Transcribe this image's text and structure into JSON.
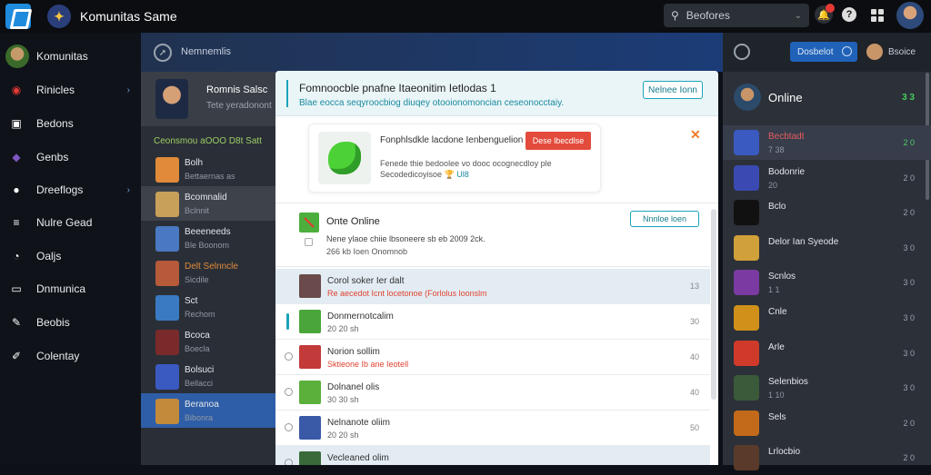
{
  "app": {
    "title": "Komunitas Same"
  },
  "search": {
    "label": "Beofores"
  },
  "sidebar": {
    "items": [
      {
        "label": "Komunitas",
        "icon": "avatar"
      },
      {
        "label": "Rinicles",
        "icon": "lips-icon",
        "color": "#e53935"
      },
      {
        "label": "Bedons",
        "icon": "briefcase-icon",
        "color": "#ffffff"
      },
      {
        "label": "Genbs",
        "icon": "puzzle-icon",
        "color": "#7e57c2"
      },
      {
        "label": "Dreeflogs",
        "icon": "gamepad-icon",
        "color": "#ffffff"
      },
      {
        "label": "Nulre Gead",
        "icon": "grid-icon",
        "color": "#ffffff"
      },
      {
        "label": "Oaljs",
        "icon": "chat-icon",
        "color": "#ffffff"
      },
      {
        "label": "Dnmunica",
        "icon": "window-icon",
        "color": "#ffffff"
      },
      {
        "label": "Beobis",
        "icon": "wrench-icon",
        "color": "#ffffff"
      },
      {
        "label": "Colentay",
        "icon": "pen-icon",
        "color": "#ffffff"
      }
    ]
  },
  "mid": {
    "header": "Nemnemlis",
    "profile": {
      "name": "Romnis Salsc",
      "sub": "Tete yeradonont"
    },
    "section": "Ceonsmou aOOO D8t Satt",
    "rows": [
      {
        "t1": "Bolh",
        "t2": "Bettaernas as",
        "color": "#e08a3a"
      },
      {
        "t1": "Bcomnalid",
        "t2": "Bclnnit",
        "color": "#c9a05a",
        "state": "sel"
      },
      {
        "t1": "Beeeneeds",
        "t2": "Ble Boonom",
        "color": "#4a78c2"
      },
      {
        "t1": "Delt Selnncle",
        "t2": "Sicdile",
        "color": "#b65a3a",
        "t1color": "#e08a3a"
      },
      {
        "t1": "Sct",
        "t2": "Rechom",
        "color": "#3a7ac2"
      },
      {
        "t1": "Bcoca",
        "t2": "Boecla",
        "color": "#7a2a2a"
      },
      {
        "t1": "Bolsuci",
        "t2": "Bellacci",
        "color": "#3a5ac2"
      },
      {
        "t1": "Beranoa",
        "t2": "Bibonra",
        "color": "#c28a3a",
        "state": "hl"
      }
    ]
  },
  "modal": {
    "title": "Fomnoocble pnafne Itaeonitim Ietlodas 1",
    "subtitle": "Blae eocca seqyroocbiog diuqey otooionomoncian ceseonocctaiy.",
    "header_button": "Nelnee Ionn",
    "promo": {
      "title": "Fonphlsdkle lacdone Ienbenguelion",
      "desc1": "Fenede thie bedoolee vo dooc ocognecdloy ple",
      "desc2": "Secodedicoyisoe",
      "desc2_link": "Ul8",
      "cta": "Dese lbecdlse"
    },
    "online": {
      "title": "Onte Online",
      "desc1": "Nene ylaoe chiie lbsoneere sb eb 2009 2ck.",
      "desc2": "266 kb Ioen Onomnob",
      "button": "Nnnloe loen"
    },
    "rows": [
      {
        "t1": "Corol soker Ier dalt",
        "t2": "Re aecedot Icnt locetonoe (Forlolus loonslm",
        "t2red": true,
        "n": "13",
        "state": "sel",
        "lead": "none",
        "color": "#6a4a4a"
      },
      {
        "t1": "Donmernotcalim",
        "t2": "20 20 sh",
        "n": "30",
        "lead": "pin",
        "color": "#4aa63a"
      },
      {
        "t1": "Norion sollim",
        "t2": "Sktieone Ib ane Ieotell",
        "t2red": true,
        "n": "40",
        "lead": "radio",
        "color": "#c23a3a"
      },
      {
        "t1": "Dolnanel olis",
        "t2": "30 30 sh",
        "n": "40",
        "lead": "radio",
        "color": "#5ab03a"
      },
      {
        "t1": "Nelnanote oliim",
        "t2": "20 20 sh",
        "n": "50",
        "lead": "radio",
        "color": "#3a5aa8"
      },
      {
        "t1": "Vecleaned olim",
        "t2": "",
        "n": "",
        "lead": "radio",
        "color": "#3a6a3a",
        "state": "sel"
      }
    ]
  },
  "right": {
    "header_button": "Dosbelot",
    "user": "Bsoice",
    "online_title": "Online",
    "online_count": "3 3",
    "rows": [
      {
        "t1": "Becbtadt",
        "t2": "7 38",
        "n": "2 0",
        "color": "#3a5ac2",
        "state": "sel"
      },
      {
        "t1": "Bodonrie",
        "t2": "20",
        "n": "2 0",
        "color": "#3a4ab2"
      },
      {
        "t1": "Bclo",
        "t2": "",
        "n": "2 0",
        "color": "#111111"
      },
      {
        "t1": "Delor Ian Syeode",
        "t2": "",
        "n": "3 0",
        "color": "#d0a03a"
      },
      {
        "t1": "Scnlos",
        "t2": "1 1",
        "n": "3 0",
        "color": "#7a3aa2"
      },
      {
        "t1": "Cnle",
        "t2": "",
        "n": "3 0",
        "color": "#d0901a"
      },
      {
        "t1": "Arle",
        "t2": "",
        "n": "3 0",
        "color": "#d03a2a"
      },
      {
        "t1": "Selenbios",
        "t2": "1 10",
        "n": "3 0",
        "color": "#3a5a3a"
      },
      {
        "t1": "Sels",
        "t2": "",
        "n": "2 0",
        "color": "#c26a1a"
      },
      {
        "t1": "Lrlocbio",
        "t2": "",
        "n": "2 0",
        "color": "#5a3a2a"
      }
    ]
  }
}
